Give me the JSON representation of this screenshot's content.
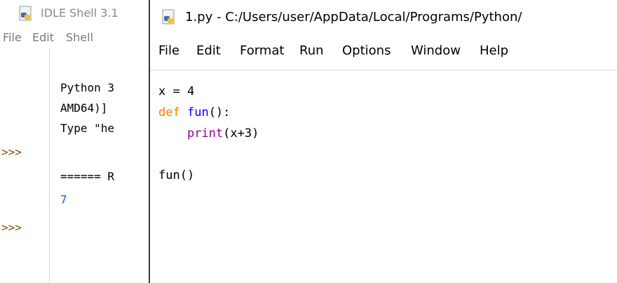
{
  "shell": {
    "title": "IDLE Shell 3.1",
    "menu": [
      "File",
      "Edit",
      "Shell"
    ],
    "lines": [
      "Python 3",
      "AMD64)]",
      "Type \"he",
      "====== R",
      "7"
    ],
    "prompts": [
      ">>>",
      ">>>"
    ]
  },
  "editor": {
    "title": "1.py - C:/Users/user/AppData/Local/Programs/Python/",
    "menu": [
      "File",
      "Edit",
      "Format",
      "Run",
      "Options",
      "Window",
      "Help"
    ],
    "code": {
      "line1": "x = 4",
      "line2_kw": "def",
      "line2_name": "fun",
      "line2_rest": "():",
      "line3_indent": "    ",
      "line3_builtin": "print",
      "line3_rest": "(x+3)",
      "line4": "",
      "line5": "fun()"
    }
  },
  "colors": {
    "keyword": "#ff7700",
    "definition": "#0000ff",
    "builtin": "#900090",
    "output": "#1c5fd6"
  },
  "icons": [
    "python-file-icon"
  ]
}
